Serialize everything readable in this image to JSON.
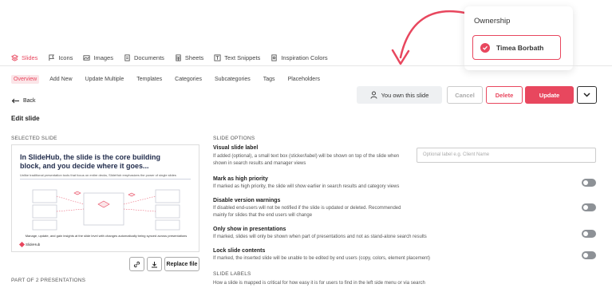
{
  "main_tabs": [
    {
      "label": "Slides",
      "active": true
    },
    {
      "label": "Icons"
    },
    {
      "label": "Images"
    },
    {
      "label": "Documents"
    },
    {
      "label": "Sheets"
    },
    {
      "label": "Text Snippets"
    },
    {
      "label": "Inspiration Colors"
    }
  ],
  "sub_tabs": [
    {
      "label": "Overview",
      "active": true
    },
    {
      "label": "Add New"
    },
    {
      "label": "Update Multiple"
    },
    {
      "label": "Templates"
    },
    {
      "label": "Categories"
    },
    {
      "label": "Subcategories"
    },
    {
      "label": "Tags"
    },
    {
      "label": "Placeholders"
    }
  ],
  "back_label": "Back",
  "page_title": "Edit slide",
  "ownership_status": "You own this slide",
  "buttons": {
    "cancel": "Cancel",
    "delete": "Delete",
    "update": "Update"
  },
  "ownership_card": {
    "title": "Ownership",
    "owner": "Timea Borbath"
  },
  "selected_slide_heading": "SELECTED SLIDE",
  "preview": {
    "kicker": "",
    "headline": "In SlideHub, the slide is the core building block, and you decide where it goes...",
    "subtitle": "Unlike traditional presentation tools that focus on entire decks, SlideHub emphasizes the power of single slides",
    "footer": "Manage, update, and gain insights at the slide level with changes automatically being synced across presentations",
    "logo": "SlideHub"
  },
  "replace_label": "Replace file",
  "part_of": "PART OF 2 PRESENTATIONS",
  "slide_options_heading": "SLIDE OPTIONS",
  "options": [
    {
      "title": "Visual slide label",
      "desc": "If added (optional), a small text box (sticker/label) will be shown on top of the slide when shown in search results and manager views"
    },
    {
      "title": "Mark as high priority",
      "desc": "If marked as high priority, the slide will show earlier in search results and category views"
    },
    {
      "title": "Disable version warnings",
      "desc": "If disabled end-users will not be notified if the slide is updated or deleted. Recommended mainly for slides that the end users will change"
    },
    {
      "title": "Only show in presentations",
      "desc": "If marked, slides will only be shown when part of presentations and not as stand-alone search results"
    },
    {
      "title": "Lock slide contents",
      "desc": "If marked, the inserted slide will be unable to be edited by end users (copy, colors, element placement)"
    }
  ],
  "label_placeholder": "Optional label e.g. Client Name",
  "slide_labels_heading": "SLIDE LABELS",
  "slide_labels_desc": "How a slide is mapped is critical for how easy it is for users to find in the left side menu or via search",
  "colors": {
    "accent": "#e8475e",
    "toggle_off": "#8d9196"
  }
}
